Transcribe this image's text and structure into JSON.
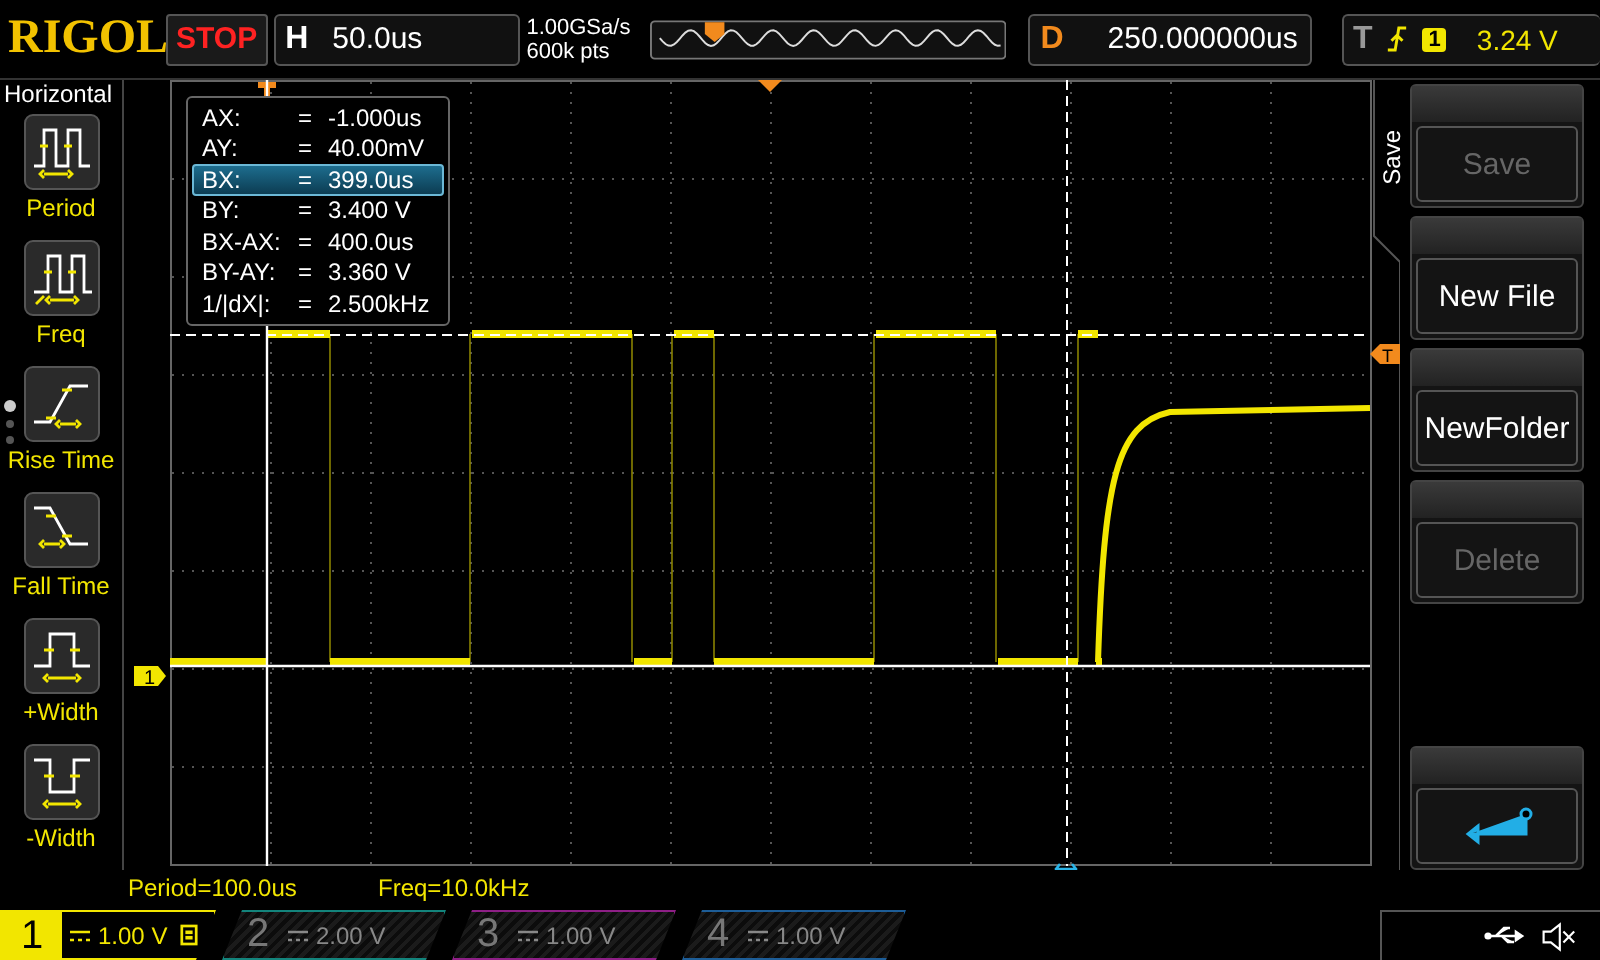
{
  "brand": "RIGOL",
  "run_state": "STOP",
  "horizontal": {
    "label": "H",
    "timebase": "50.0us"
  },
  "acquisition": {
    "sample_rate": "1.00GSa/s",
    "memory_depth": "600k pts"
  },
  "delay": {
    "label": "D",
    "value": "250.000000us"
  },
  "trigger": {
    "label": "T",
    "source": "1",
    "level": "3.24 V"
  },
  "left_menu": {
    "title": "Horizontal",
    "items": [
      {
        "kind": "period",
        "label": "Period"
      },
      {
        "kind": "freq",
        "label": "Freq"
      },
      {
        "kind": "rise",
        "label": "Rise Time"
      },
      {
        "kind": "fall",
        "label": "Fall Time"
      },
      {
        "kind": "pwidth",
        "label": "+Width"
      },
      {
        "kind": "nwidth",
        "label": "-Width"
      }
    ],
    "pages": [
      {
        "selected": true
      },
      {
        "selected": false
      },
      {
        "selected": false
      }
    ]
  },
  "cursor_readout": [
    {
      "label": "AX:",
      "sign": "=",
      "value": "-1.000us",
      "selected": false
    },
    {
      "label": "AY:",
      "sign": "=",
      "value": "40.00mV",
      "selected": false
    },
    {
      "label": "BX:",
      "sign": "=",
      "value": "399.0us",
      "selected": true
    },
    {
      "label": "BY:",
      "sign": "=",
      "value": "3.400 V",
      "selected": false
    },
    {
      "label": "BX-AX:",
      "sign": "=",
      "value": "400.0us",
      "selected": false
    },
    {
      "label": "BY-AY:",
      "sign": "=",
      "value": "3.360 V",
      "selected": false
    },
    {
      "label": "1/|dX|:",
      "sign": "=",
      "value": "2.500kHz",
      "selected": false
    }
  ],
  "channel_marker": "1",
  "trigger_level_marker": "T",
  "menu_title": "Save",
  "softkeys": [
    {
      "kind": "text",
      "label": "Save",
      "disabled": true
    },
    {
      "kind": "text",
      "label": "New File",
      "disabled": false
    },
    {
      "kind": "text",
      "label": "NewFolder",
      "disabled": false
    },
    {
      "kind": "text",
      "label": "Delete",
      "disabled": true
    },
    {
      "kind": "return"
    }
  ],
  "measurements": [
    "Period=100.0us",
    "Freq=10.0kHz"
  ],
  "channels": [
    {
      "number": "1",
      "scale": "1.00 V",
      "enabled": true,
      "color": "#f2e600"
    },
    {
      "number": "2",
      "scale": "2.00 V",
      "enabled": false,
      "color": "#13847c"
    },
    {
      "number": "3",
      "scale": "1.00 V",
      "enabled": false,
      "color": "#8e1f86"
    },
    {
      "number": "4",
      "scale": "1.00 V",
      "enabled": false,
      "color": "#1d5d97"
    }
  ]
}
